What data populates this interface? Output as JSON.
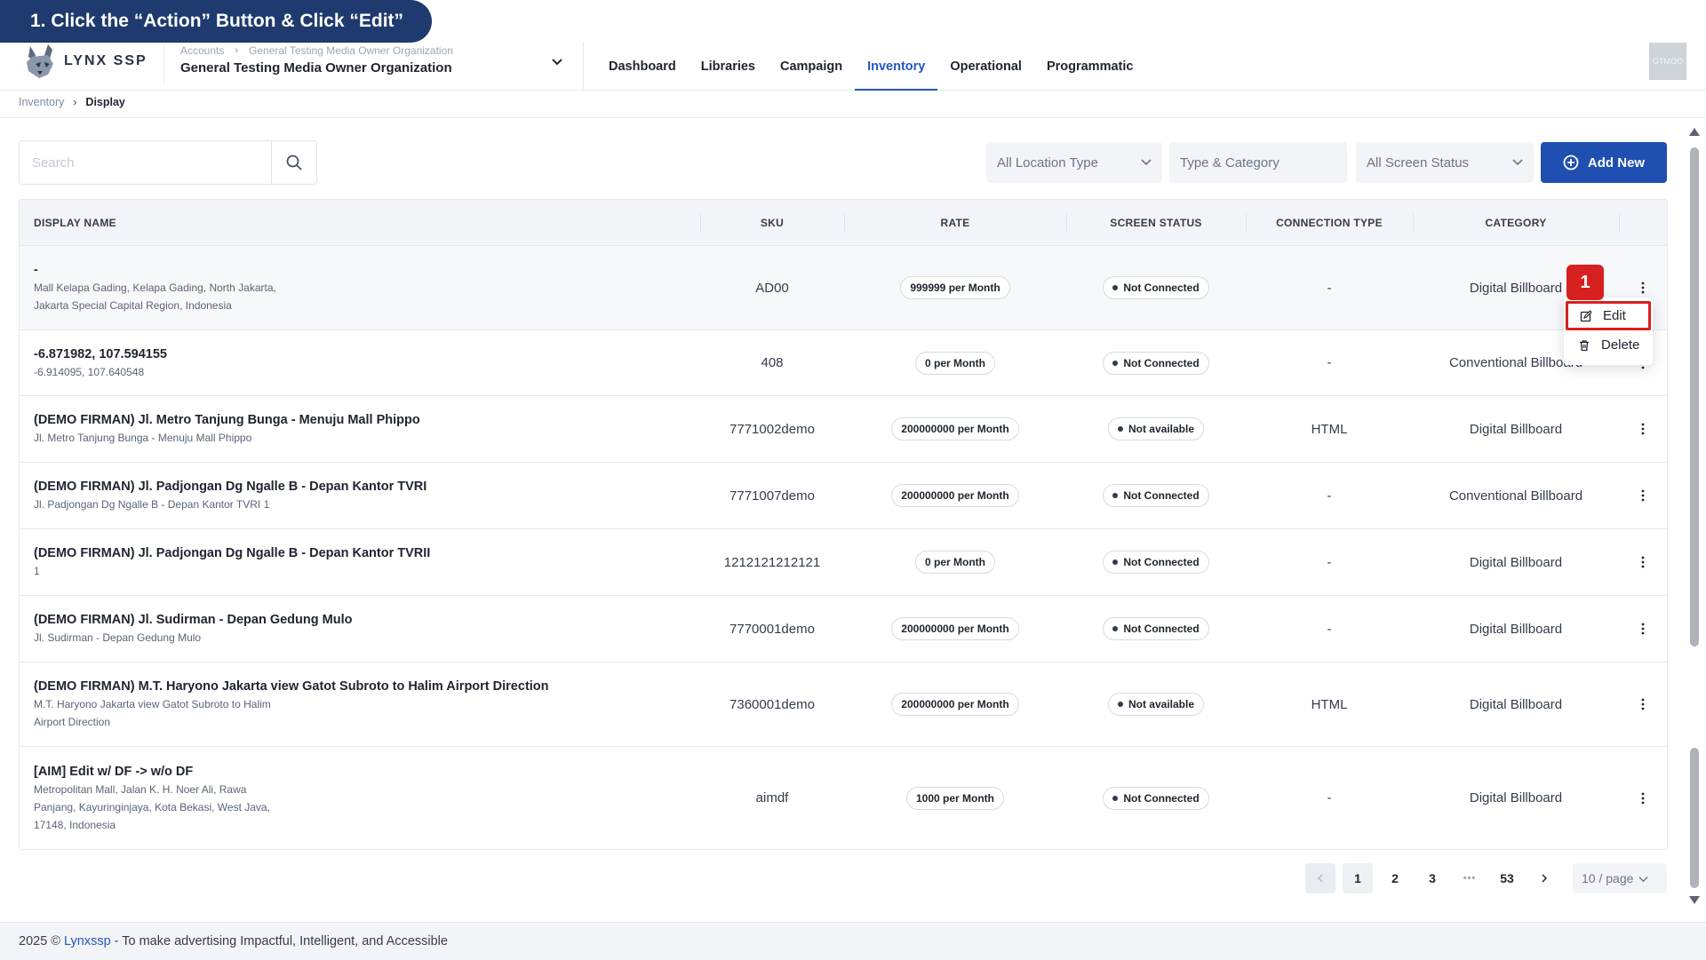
{
  "instruction": "1. Click the “Action” Button & Click “Edit”",
  "app": {
    "logo_text": "LYNX SSP",
    "org_breadcrumb": [
      "Accounts",
      "General Testing Media Owner Organization"
    ],
    "org_name": "General Testing Media Owner Organization",
    "nav": [
      "Dashboard",
      "Libraries",
      "Campaign",
      "Inventory",
      "Operational",
      "Programmatic"
    ],
    "nav_active": "Inventory",
    "avatar_text": "GTMOO"
  },
  "breadcrumb": {
    "parent": "Inventory",
    "current": "Display"
  },
  "toolbar": {
    "search_placeholder": "Search",
    "filters": [
      "All Location Type",
      "Type & Category",
      "All Screen Status"
    ],
    "add_new_label": "Add New"
  },
  "table": {
    "headers": [
      "DISPLAY NAME",
      "SKU",
      "RATE",
      "SCREEN STATUS",
      "CONNECTION TYPE",
      "CATEGORY"
    ],
    "rows": [
      {
        "title": "-",
        "sub": [
          "Mall Kelapa Gading, Kelapa Gading, North Jakarta,",
          "Jakarta Special Capital Region, Indonesia"
        ],
        "sku": "AD00",
        "rate": "999999 per Month",
        "status": "Not Connected",
        "conn": "-",
        "category": "Digital Billboard"
      },
      {
        "title": "-6.871982, 107.594155",
        "sub": [
          "-6.914095, 107.640548"
        ],
        "sku": "408",
        "rate": "0 per Month",
        "status": "Not Connected",
        "conn": "-",
        "category": "Conventional Billboard"
      },
      {
        "title": "(DEMO FIRMAN) Jl. Metro Tanjung Bunga - Menuju Mall Phippo",
        "sub": [
          "Jl. Metro Tanjung Bunga - Menuju Mall Phippo"
        ],
        "sku": "7771002demo",
        "rate": "200000000 per Month",
        "status": "Not available",
        "conn": "HTML",
        "category": "Digital Billboard"
      },
      {
        "title": "(DEMO FIRMAN) Jl. Padjongan Dg Ngalle B - Depan Kantor TVRI",
        "sub": [
          "Jl. Padjongan Dg Ngalle B - Depan Kantor TVRI 1"
        ],
        "sku": "7771007demo",
        "rate": "200000000 per Month",
        "status": "Not Connected",
        "conn": "-",
        "category": "Conventional Billboard"
      },
      {
        "title": "(DEMO FIRMAN) Jl. Padjongan Dg Ngalle B - Depan Kantor TVRII",
        "sub": [
          "1"
        ],
        "sku": "1212121212121",
        "rate": "0 per Month",
        "status": "Not Connected",
        "conn": "-",
        "category": "Digital Billboard"
      },
      {
        "title": "(DEMO FIRMAN) Jl. Sudirman - Depan Gedung Mulo",
        "sub": [
          "Jl. Sudirman - Depan Gedung Mulo"
        ],
        "sku": "7770001demo",
        "rate": "200000000 per Month",
        "status": "Not Connected",
        "conn": "-",
        "category": "Digital Billboard"
      },
      {
        "title": "(DEMO FIRMAN) M.T. Haryono Jakarta view Gatot Subroto to Halim Airport Direction",
        "sub": [
          "M.T. Haryono Jakarta view Gatot Subroto to Halim",
          "Airport Direction"
        ],
        "sku": "7360001demo",
        "rate": "200000000 per Month",
        "status": "Not available",
        "conn": "HTML",
        "category": "Digital Billboard"
      },
      {
        "title": "[AIM] Edit w/ DF -> w/o DF",
        "sub": [
          "Metropolitan Mall, Jalan K. H. Noer Ali, Rawa",
          "Panjang, Kayuringinjaya, Kota Bekasi, West Java,",
          "17148, Indonesia"
        ],
        "sku": "aimdf",
        "rate": "1000 per Month",
        "status": "Not Connected",
        "conn": "-",
        "category": "Digital Billboard"
      }
    ]
  },
  "action_menu": {
    "badge": "1",
    "edit_label": "Edit",
    "delete_label": "Delete"
  },
  "pagination": {
    "pages": [
      "1",
      "2",
      "3"
    ],
    "ellipsis": "•••",
    "last_page": "53",
    "current": "1",
    "page_size": "10 / page"
  },
  "footer": {
    "prefix": "2025 ©",
    "brand": "Lynxssp",
    "tagline": "- To make advertising Impactful, Intelligent, and Accessible"
  },
  "colors": {
    "primary": "#1f4fb0",
    "nav_active": "#2456c2",
    "banner": "#1e3a6e",
    "annotation_red": "#d72020"
  }
}
